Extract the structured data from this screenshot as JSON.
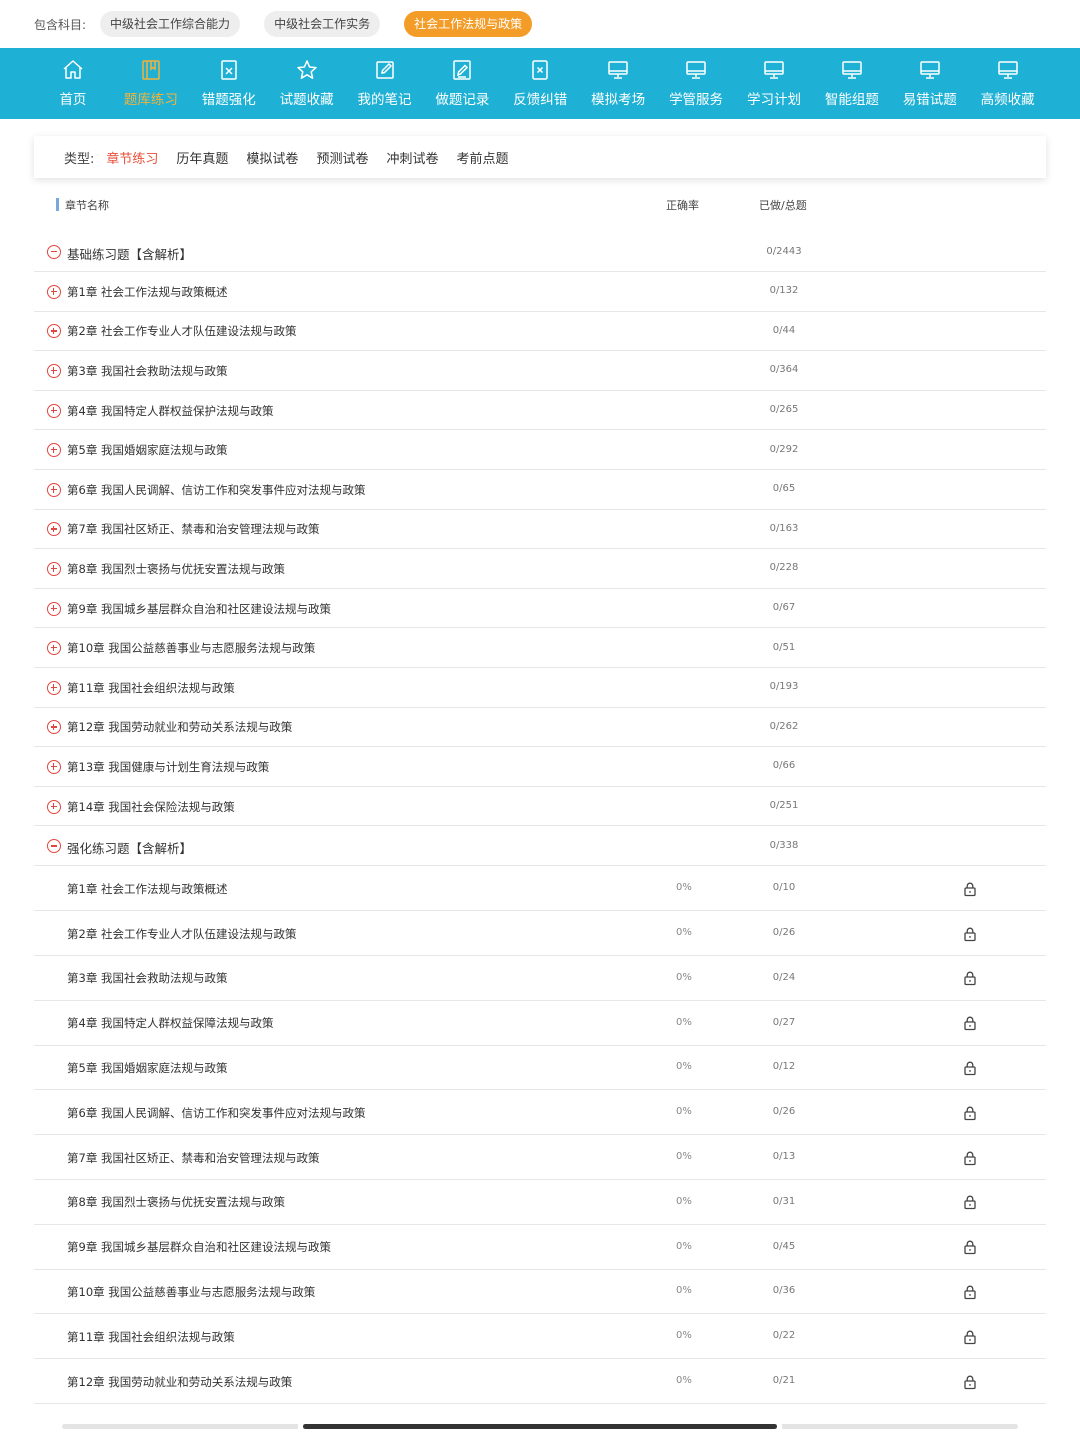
{
  "subjects": {
    "label": "包含科目:",
    "items": [
      "中级社会工作综合能力",
      "中级社会工作实务",
      "社会工作法规与政策"
    ],
    "active_index": 2
  },
  "nav": {
    "items": [
      {
        "label": "首页",
        "icon": "home-icon"
      },
      {
        "label": "题库练习",
        "icon": "book-icon"
      },
      {
        "label": "错题强化",
        "icon": "error-sheet-icon"
      },
      {
        "label": "试题收藏",
        "icon": "star-icon"
      },
      {
        "label": "我的笔记",
        "icon": "edit-icon"
      },
      {
        "label": "做题记录",
        "icon": "record-icon"
      },
      {
        "label": "反馈纠错",
        "icon": "feedback-icon"
      },
      {
        "label": "模拟考场",
        "icon": "monitor-icon"
      },
      {
        "label": "学管服务",
        "icon": "monitor-icon"
      },
      {
        "label": "学习计划",
        "icon": "monitor-icon"
      },
      {
        "label": "智能组题",
        "icon": "monitor-icon"
      },
      {
        "label": "易错试题",
        "icon": "monitor-icon"
      },
      {
        "label": "高频收藏",
        "icon": "monitor-icon"
      }
    ],
    "active_index": 1,
    "bg_color": "#1eb1d5",
    "active_color": "#f3b33b"
  },
  "types": {
    "label": "类型:",
    "tabs": [
      "章节练习",
      "历年真题",
      "模拟试卷",
      "预测试卷",
      "冲刺试卷",
      "考前点题"
    ],
    "active_index": 0,
    "active_color": "#e8503a"
  },
  "table": {
    "headers": {
      "name": "章节名称",
      "rate": "正确率",
      "done": "已做/总题"
    },
    "rows": [
      {
        "type": "group",
        "expanded": true,
        "name": "基础练习题【含解析】",
        "count": "0/2443"
      },
      {
        "type": "chapter",
        "toggle": "plus",
        "name": "第1章 社会工作法规与政策概述",
        "count": "0/132"
      },
      {
        "type": "chapter",
        "toggle": "plus",
        "name": "第2章 社会工作专业人才队伍建设法规与政策",
        "count": "0/44"
      },
      {
        "type": "chapter",
        "toggle": "plus",
        "name": "第3章 我国社会救助法规与政策",
        "count": "0/364"
      },
      {
        "type": "chapter",
        "toggle": "plus",
        "name": "第4章 我国特定人群权益保护法规与政策",
        "count": "0/265"
      },
      {
        "type": "chapter",
        "toggle": "plus",
        "name": "第5章 我国婚姻家庭法规与政策",
        "count": "0/292"
      },
      {
        "type": "chapter",
        "toggle": "plus",
        "name": "第6章 我国人民调解、信访工作和突发事件应对法规与政策",
        "count": "0/65"
      },
      {
        "type": "chapter",
        "toggle": "plus",
        "name": "第7章 我国社区矫正、禁毒和治安管理法规与政策",
        "count": "0/163"
      },
      {
        "type": "chapter",
        "toggle": "plus",
        "name": "第8章 我国烈士褒扬与优抚安置法规与政策",
        "count": "0/228"
      },
      {
        "type": "chapter",
        "toggle": "plus",
        "name": "第9章 我国城乡基层群众自治和社区建设法规与政策",
        "count": "0/67"
      },
      {
        "type": "chapter",
        "toggle": "plus",
        "name": "第10章 我国公益慈善事业与志愿服务法规与政策",
        "count": "0/51"
      },
      {
        "type": "chapter",
        "toggle": "plus",
        "name": "第11章 我国社会组织法规与政策",
        "count": "0/193"
      },
      {
        "type": "chapter",
        "toggle": "plus",
        "name": "第12章 我国劳动就业和劳动关系法规与政策",
        "count": "0/262"
      },
      {
        "type": "chapter",
        "toggle": "plus",
        "name": "第13章 我国健康与计划生育法规与政策",
        "count": "0/66"
      },
      {
        "type": "chapter",
        "toggle": "plus",
        "name": "第14章 我国社会保险法规与政策",
        "count": "0/251"
      },
      {
        "type": "group",
        "expanded": true,
        "name": "强化练习题【含解析】",
        "count": "0/338"
      },
      {
        "type": "item",
        "name": "第1章 社会工作法规与政策概述",
        "rate": "0%",
        "count": "0/10",
        "locked": true
      },
      {
        "type": "item",
        "name": "第2章 社会工作专业人才队伍建设法规与政策",
        "rate": "0%",
        "count": "0/26",
        "locked": true
      },
      {
        "type": "item",
        "name": "第3章 我国社会救助法规与政策",
        "rate": "0%",
        "count": "0/24",
        "locked": true
      },
      {
        "type": "item",
        "name": "第4章 我国特定人群权益保障法规与政策",
        "rate": "0%",
        "count": "0/27",
        "locked": true
      },
      {
        "type": "item",
        "name": "第5章 我国婚姻家庭法规与政策",
        "rate": "0%",
        "count": "0/12",
        "locked": true
      },
      {
        "type": "item",
        "name": "第6章 我国人民调解、信访工作和突发事件应对法规与政策",
        "rate": "0%",
        "count": "0/26",
        "locked": true
      },
      {
        "type": "item",
        "name": "第7章 我国社区矫正、禁毒和治安管理法规与政策",
        "rate": "0%",
        "count": "0/13",
        "locked": true
      },
      {
        "type": "item",
        "name": "第8章 我国烈士褒扬与优抚安置法规与政策",
        "rate": "0%",
        "count": "0/31",
        "locked": true
      },
      {
        "type": "item",
        "name": "第9章 我国城乡基层群众自治和社区建设法规与政策",
        "rate": "0%",
        "count": "0/45",
        "locked": true
      },
      {
        "type": "item",
        "name": "第10章 我国公益慈善事业与志愿服务法规与政策",
        "rate": "0%",
        "count": "0/36",
        "locked": true
      },
      {
        "type": "item",
        "name": "第11章 我国社会组织法规与政策",
        "rate": "0%",
        "count": "0/22",
        "locked": true
      },
      {
        "type": "item",
        "name": "第12章 我国劳动就业和劳动关系法规与政策",
        "rate": "0%",
        "count": "0/21",
        "locked": true
      }
    ]
  }
}
